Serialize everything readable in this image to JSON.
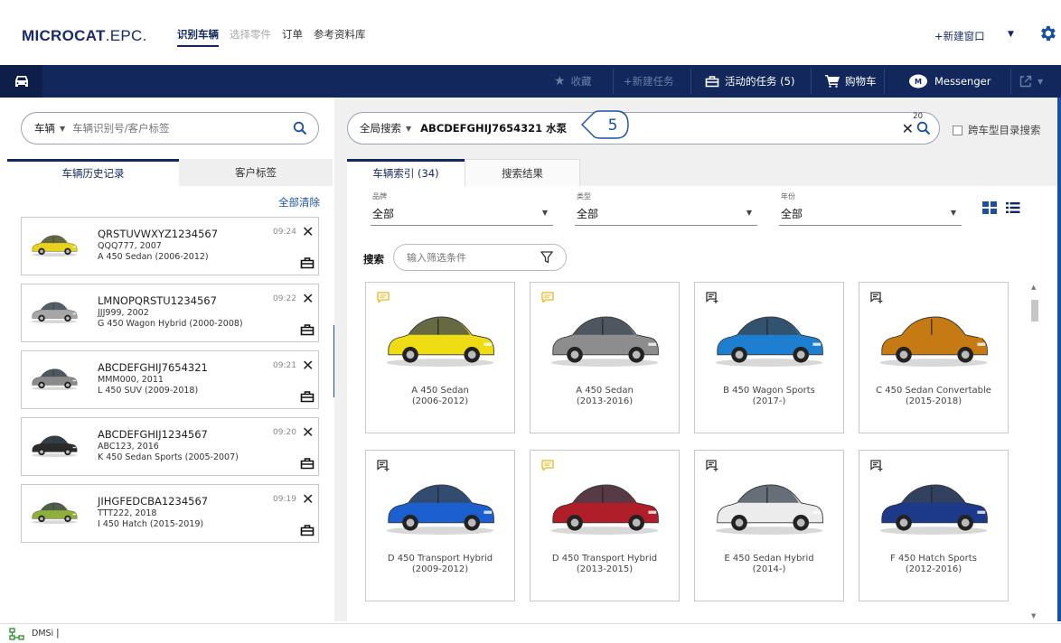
{
  "header": {
    "logo_main": "MICROCAT",
    "logo_sub": ".EPC.",
    "nav": [
      {
        "label": "识别车辆",
        "state": "active"
      },
      {
        "label": "选择零件",
        "state": "muted"
      },
      {
        "label": "订单",
        "state": "normal"
      },
      {
        "label": "参考资料库",
        "state": "normal"
      }
    ],
    "new_window": "+新建窗口"
  },
  "toolbar": {
    "favorites": "收藏",
    "new_task": "+新建任务",
    "active_tasks": "活动的任务 (5)",
    "cart": "购物车",
    "messenger": "Messenger"
  },
  "left_panel": {
    "search_selector": "车辆",
    "search_placeholder": "车辆识别号/客户标签",
    "tabs": [
      "车辆历史记录",
      "客户标签"
    ],
    "clear_all": "全部清除",
    "history": [
      {
        "vin": "QRSTUVWXYZ1234567",
        "plate": "QQQ777, 2007",
        "model": "A 450 Sedan (2006-2012)",
        "time": "09:24",
        "color": "#e8d21c"
      },
      {
        "vin": "LMNOPQRSTU1234567",
        "plate": "JJJ999, 2002",
        "model": "G 450 Wagon Hybrid (2000-2008)",
        "time": "09:22",
        "color": "#a6a6a6"
      },
      {
        "vin": "ABCDEFGHIJ7654321",
        "plate": "MMM000, 2011",
        "model": "L 450 SUV (2009-2018)",
        "time": "09:21",
        "color": "#8a8a8a"
      },
      {
        "vin": "ABCDEFGHIJ1234567",
        "plate": "ABC123, 2016",
        "model": "K 450 Sedan Sports (2005-2007)",
        "time": "09:20",
        "color": "#2b2b2b"
      },
      {
        "vin": "JIHGFEDCBA1234567",
        "plate": "TTT222, 2018",
        "model": "I 450 Hatch (2015-2019)",
        "time": "09:19",
        "color": "#8fae3a"
      }
    ]
  },
  "right_panel": {
    "search_selector": "全局搜索",
    "search_query": "ABCDEFGHIJ7654321 水泵",
    "result_count": "20",
    "callout_number": "5",
    "cross_catalog": "跨车型目录搜索",
    "tabs": [
      "车辆索引 (34)",
      "搜索结果"
    ],
    "filters": [
      {
        "label": "品牌",
        "value": "全部"
      },
      {
        "label": "类型",
        "value": "全部"
      },
      {
        "label": "年份",
        "value": "全部"
      }
    ],
    "search_label": "搜索",
    "filter_placeholder": "输入筛选条件",
    "vehicles": [
      {
        "name": "A 450 Sedan",
        "years": "(2006-2012)",
        "color": "#f0dc14",
        "note": "yellow"
      },
      {
        "name": "A 450 Sedan",
        "years": "(2013-2016)",
        "color": "#8d8d8d",
        "note": "yellow"
      },
      {
        "name": "B 450 Wagon Sports",
        "years": "(2017-)",
        "color": "#1e7fd0",
        "note": "add"
      },
      {
        "name": "C 450 Sedan Convertable",
        "years": "(2015-2018)",
        "color": "#c57a14",
        "note": "add"
      },
      {
        "name": "D 450 Transport Hybrid",
        "years": "(2009-2012)",
        "color": "#1c5fcf",
        "note": "add"
      },
      {
        "name": "D 450 Transport Hybrid",
        "years": "(2013-2015)",
        "color": "#b01e2a",
        "note": "yellow"
      },
      {
        "name": "E 450 Sedan Hybrid",
        "years": "(2014-)",
        "color": "#ececec",
        "note": "add"
      },
      {
        "name": "F 450 Hatch Sports",
        "years": "(2012-2016)",
        "color": "#1d3a8a",
        "note": "add"
      }
    ]
  },
  "status_bar": {
    "dms": "DMSi"
  }
}
